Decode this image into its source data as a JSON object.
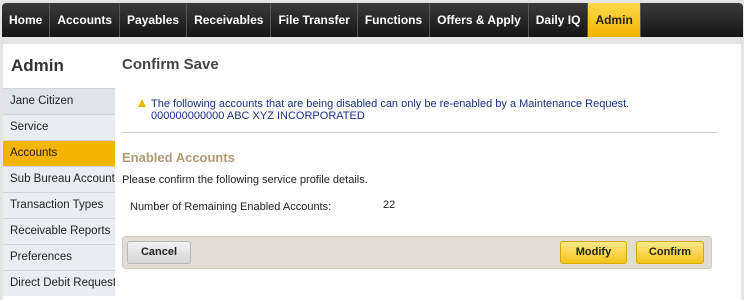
{
  "topnav": {
    "items": [
      "Home",
      "Accounts",
      "Payables",
      "Receivables",
      "File Transfer",
      "Functions",
      "Offers & Apply",
      "Daily IQ",
      "Admin"
    ],
    "active": "Admin"
  },
  "sidebar": {
    "title": "Admin",
    "items": [
      "Jane Citizen",
      "Service",
      "Accounts",
      "Sub Bureau Accounts",
      "Transaction Types",
      "Receivable Reports",
      "Preferences",
      "Direct Debit Requests"
    ],
    "selected": "Accounts"
  },
  "main": {
    "title": "Confirm Save",
    "warning_line1": "The following accounts that are being disabled can only be re-enabled by a Maintenance Request.",
    "warning_line2": "000000000000 ABC XYZ INCORPORATED",
    "section_title": "Enabled Accounts",
    "description": "Please confirm the following service profile details.",
    "row_label": "Number of Remaining Enabled Accounts:",
    "row_value": "22"
  },
  "actions": {
    "cancel": "Cancel",
    "modify": "Modify",
    "confirm": "Confirm"
  },
  "colors": {
    "accent": "#f5b400",
    "warning_text": "#1a2e8a",
    "section_title": "#b09a76"
  }
}
